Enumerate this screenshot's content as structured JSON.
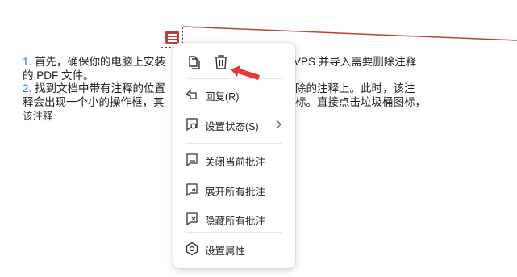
{
  "document": {
    "line1_num": "1.",
    "line1_a": "首先，确保你的电脑上安装",
    "line1_b": "VPS 并导入需要删除注释",
    "line2": "的 PDF 文件。",
    "line3_num": "2.",
    "line3_a": "找到文档中带有注释的位置",
    "line3_b": "除的注释上。此时，该注",
    "line4_a": "释会出现一个小的操作框，其",
    "line4_b": "标。直接点击垃圾桶图标，",
    "line5": "该注释"
  },
  "context_menu": {
    "top_icons": [
      "copy-icon",
      "trash-icon"
    ],
    "items": [
      {
        "label": "回复(R)",
        "icon": "reply-icon"
      },
      {
        "label": "设置状态(S)",
        "icon": "set-status-icon",
        "has_submenu": true
      },
      {
        "label": "关闭当前批注",
        "icon": "close-comment-icon"
      },
      {
        "label": "展开所有批注",
        "icon": "expand-comments-icon"
      },
      {
        "label": "隐藏所有批注",
        "icon": "hide-comments-icon"
      },
      {
        "label": "设置属性",
        "icon": "properties-icon"
      }
    ]
  },
  "colors": {
    "accent_blue": "#2f6fde",
    "marker_red": "#b7443a",
    "arrow_red": "#e4393c"
  }
}
